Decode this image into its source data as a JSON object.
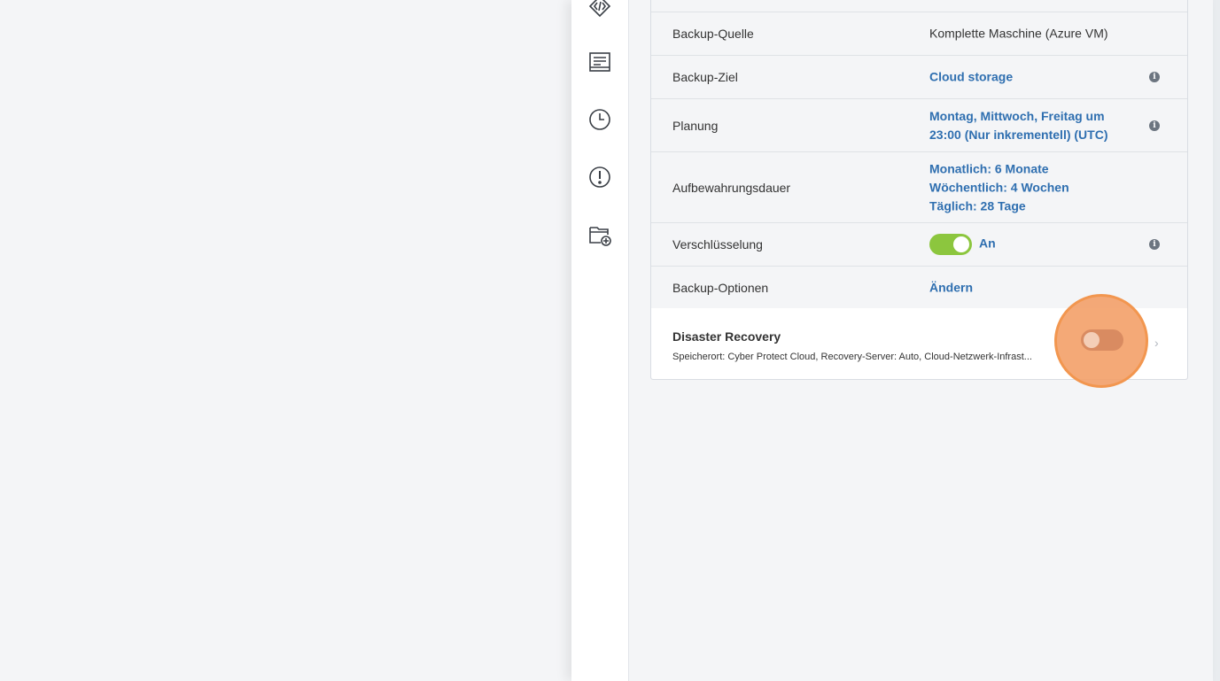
{
  "nav_icons": [
    {
      "name": "code-icon"
    },
    {
      "name": "list-icon"
    },
    {
      "name": "clock-icon"
    },
    {
      "name": "alert-icon"
    },
    {
      "name": "folder-add-icon"
    }
  ],
  "plan": {
    "backup_source": {
      "label": "Backup-Quelle",
      "value": "Komplette Maschine (Azure VM)"
    },
    "backup_target": {
      "label": "Backup-Ziel",
      "value": "Cloud storage"
    },
    "schedule": {
      "label": "Planung",
      "value_line1": "Montag, Mittwoch, Freitag um",
      "value_line2": "23:00 (Nur inkrementell) (UTC)"
    },
    "retention": {
      "label": "Aufbewahrungsdauer",
      "monthly": "Monatlich: 6 Monate",
      "weekly": "Wöchentlich: 4 Wochen",
      "daily": "Täglich: 28 Tage"
    },
    "encryption": {
      "label": "Verschlüsselung",
      "state": "An",
      "enabled": true
    },
    "backup_options": {
      "label": "Backup-Optionen",
      "action": "Ändern"
    },
    "disaster_recovery": {
      "title": "Disaster Recovery",
      "subtitle": "Speicherort: Cyber Protect Cloud, Recovery-Server: Auto, Cloud-Netzwerk-Infrast...",
      "enabled": false
    }
  },
  "info_icon_glyph": "i",
  "chevron_glyph": "›",
  "colors": {
    "link": "#2f6fb0",
    "toggle_on": "#8cc63e",
    "highlight": "#f3a068",
    "background": "#f4f5f7"
  }
}
